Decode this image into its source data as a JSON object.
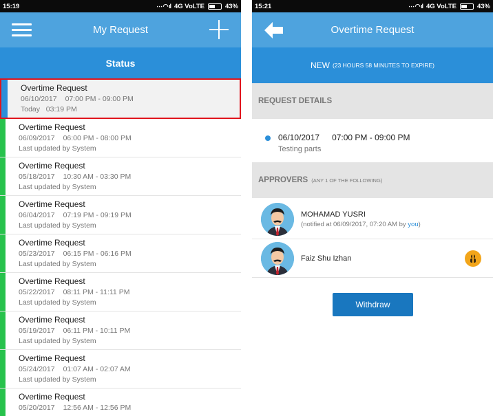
{
  "left": {
    "statusbar": {
      "time": "15:19",
      "network": "4G VoLTE",
      "battery": "43%"
    },
    "appbar": {
      "title": "My Request"
    },
    "subbar": {
      "title": "Status"
    },
    "requests": [
      {
        "title": "Overtime Request",
        "date": "06/10/2017",
        "time": "07:00 PM - 09:00 PM",
        "status": "Today   03:19 PM"
      },
      {
        "title": "Overtime Request",
        "date": "06/09/2017",
        "time": "06:00 PM - 08:00 PM",
        "status": "Last updated by System"
      },
      {
        "title": "Overtime Request",
        "date": "05/18/2017",
        "time": "10:30 AM - 03:30 PM",
        "status": "Last updated by System"
      },
      {
        "title": "Overtime Request",
        "date": "06/04/2017",
        "time": "07:19 PM - 09:19 PM",
        "status": "Last updated by System"
      },
      {
        "title": "Overtime Request",
        "date": "05/23/2017",
        "time": "06:15 PM - 06:16 PM",
        "status": "Last updated by System"
      },
      {
        "title": "Overtime Request",
        "date": "05/22/2017",
        "time": "08:11 PM - 11:11 PM",
        "status": "Last updated by System"
      },
      {
        "title": "Overtime Request",
        "date": "05/19/2017",
        "time": "06:11 PM - 10:11 PM",
        "status": "Last updated by System"
      },
      {
        "title": "Overtime Request",
        "date": "05/24/2017",
        "time": "01:07 AM - 02:07 AM",
        "status": "Last updated by System"
      },
      {
        "title": "Overtime Request",
        "date": "05/20/2017",
        "time": "12:56 AM - 12:56 PM",
        "status": ""
      }
    ]
  },
  "right": {
    "statusbar": {
      "time": "15:21",
      "network": "4G VoLTE",
      "battery": "43%"
    },
    "appbar": {
      "title": "Overtime Request"
    },
    "state": {
      "label": "NEW",
      "expiry": "(23 HOURS 58 MINUTES TO EXPIRE)"
    },
    "details_section": {
      "title": "REQUEST DETAILS"
    },
    "detail": {
      "date": "06/10/2017",
      "time": "07:00 PM - 09:00 PM",
      "note": "Testing parts"
    },
    "approvers_section": {
      "title": "APPROVERS",
      "hint": "(ANY 1 OF THE FOLLOWING)"
    },
    "approvers": [
      {
        "name": "MOHAMAD YUSRI",
        "note_prefix": "(notified at 06/09/2017, 07:20 AM by ",
        "note_you": "you",
        "note_suffix": ")"
      },
      {
        "name": "Faiz Shu Izhan"
      }
    ],
    "withdraw_label": "Withdraw"
  },
  "colors": {
    "appbar": "#4ea3de",
    "accent": "#2b8fd9",
    "selected_outline": "#e0141c",
    "status_green": "#27c24c",
    "badge": "#f2a51a"
  }
}
